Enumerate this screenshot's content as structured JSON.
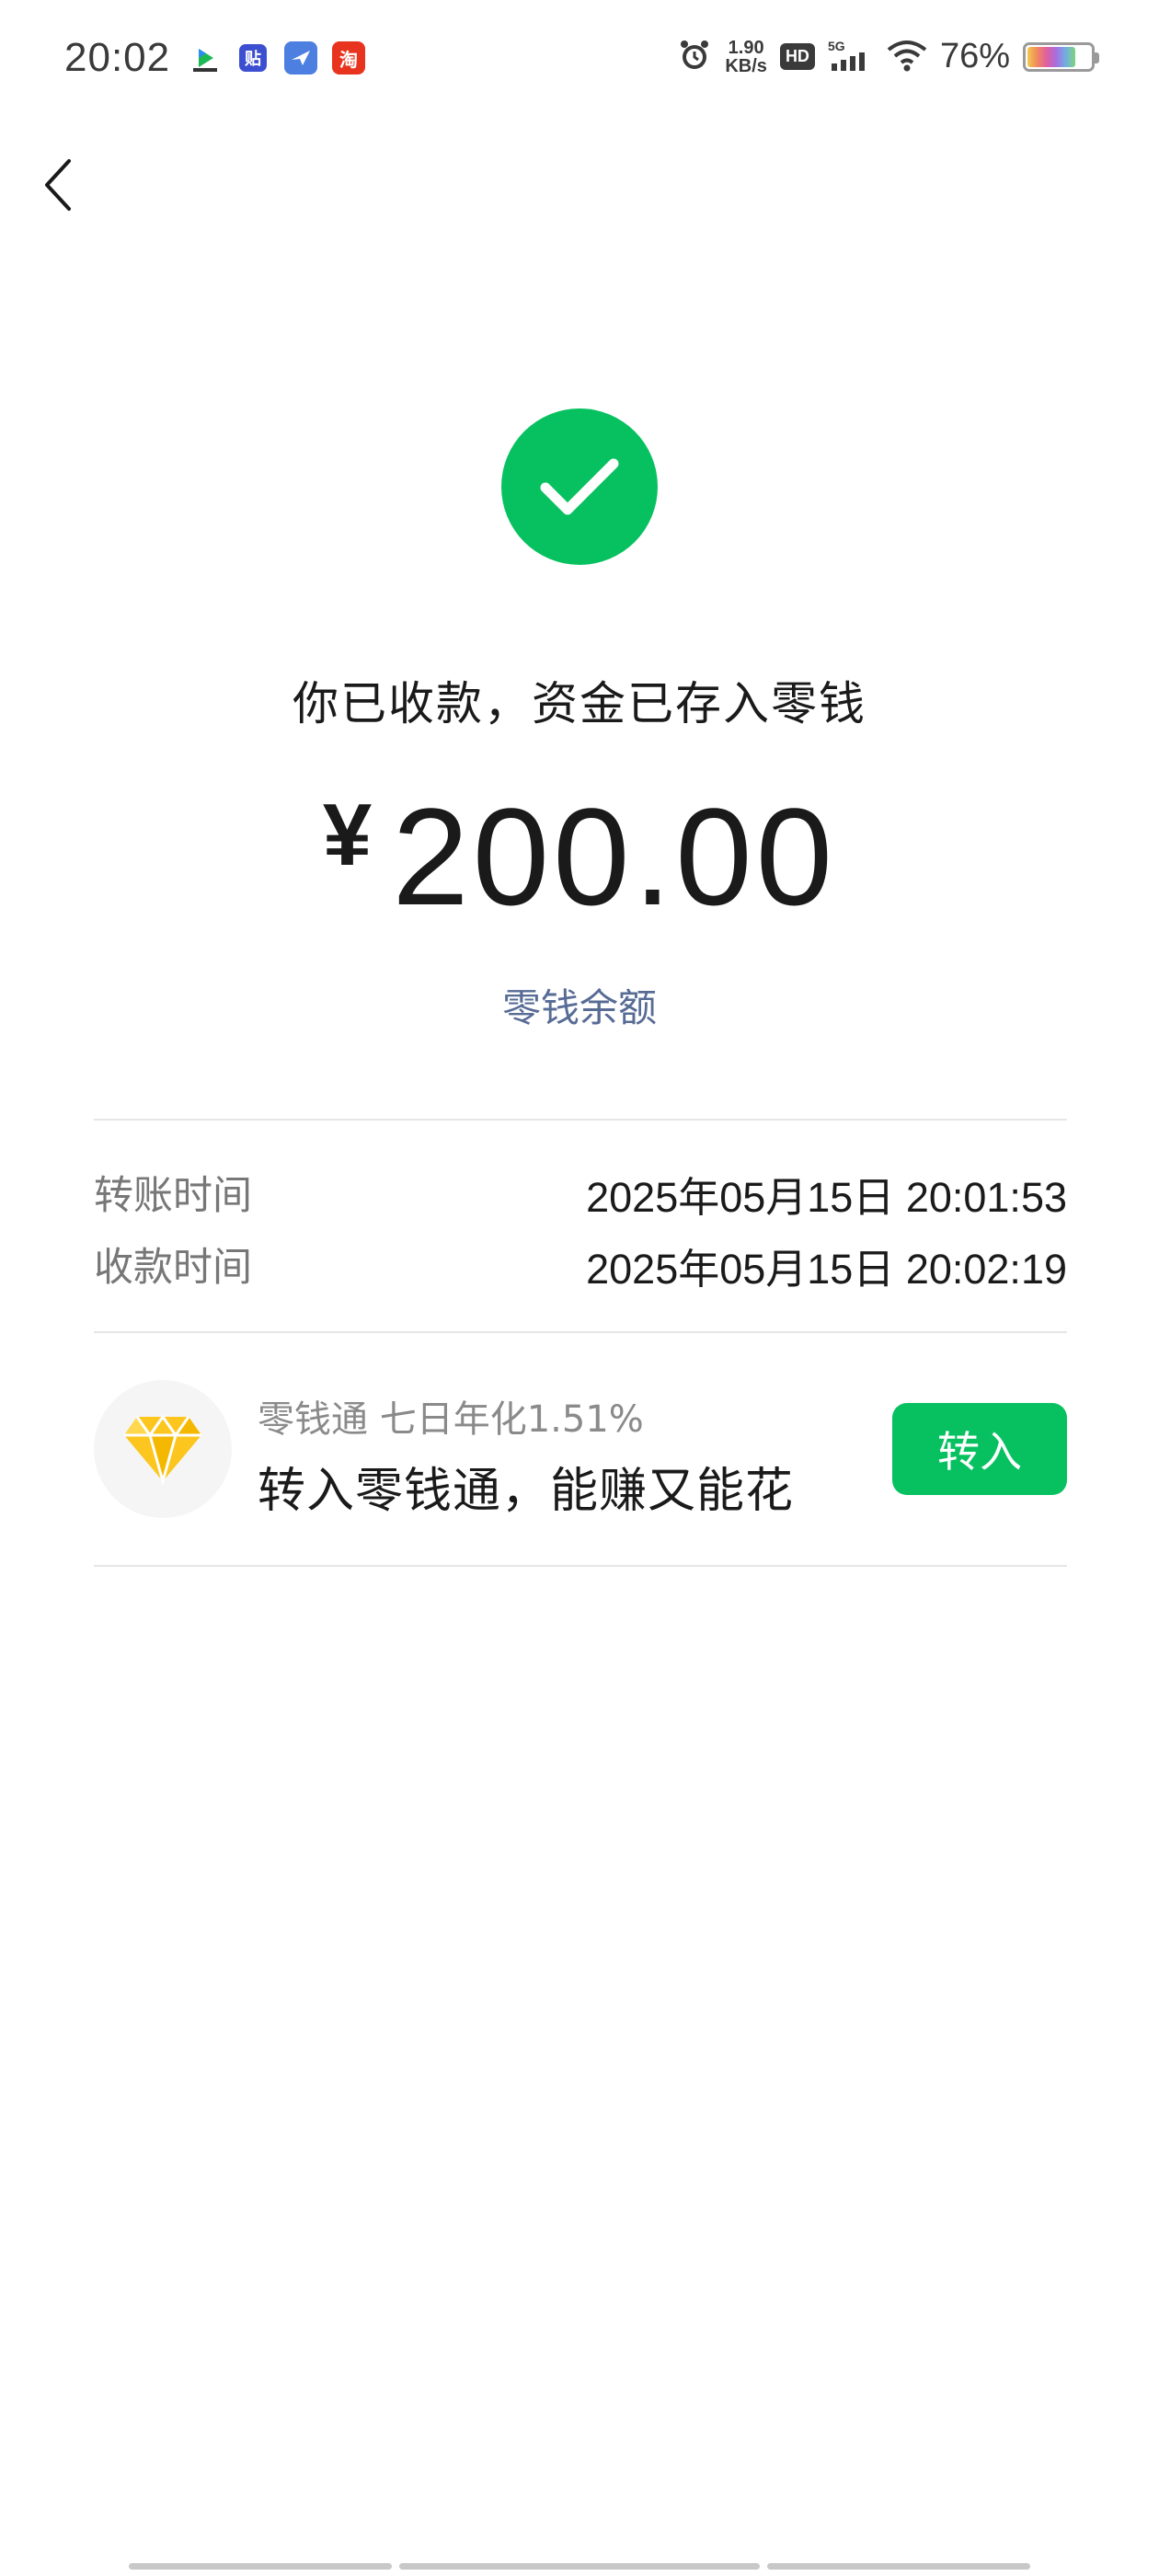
{
  "status_bar": {
    "time": "20:02",
    "app_icons": [
      "video-app-icon",
      "tieba-icon",
      "fly-app-icon",
      "taobao-icon"
    ],
    "tieba_glyph": "贴",
    "taobao_glyph": "淘",
    "net_speed_value": "1.90",
    "net_speed_unit": "KB/s",
    "hd_label": "HD",
    "network": "5G",
    "battery_percent": "76%",
    "battery_level": 0.76
  },
  "header": {
    "back_icon": "chevron-left-icon"
  },
  "receipt": {
    "title": "你已收款，资金已存入零钱",
    "currency": "¥",
    "amount": "200.00",
    "balance_link": "零钱余额",
    "accent_color": "#07c160",
    "link_color": "#576b95"
  },
  "details": {
    "rows": [
      {
        "label": "转账时间",
        "value": "2025年05月15日 20:01:53"
      },
      {
        "label": "收款时间",
        "value": "2025年05月15日 20:02:19"
      }
    ]
  },
  "promo": {
    "icon": "diamond-icon",
    "subtitle": "零钱通 七日年化1.51%",
    "title": "转入零钱通，能赚又能花",
    "button_label": "转入"
  }
}
